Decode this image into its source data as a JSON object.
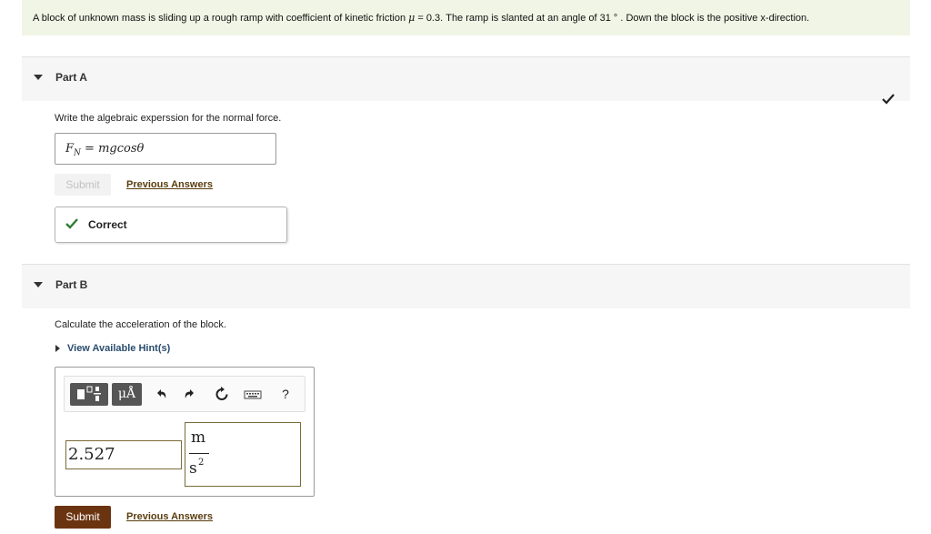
{
  "problem": {
    "text_before": "A block of unknown mass is sliding up a rough ramp with coefficient of kinetic friction ",
    "mu_symbol": "μ",
    "text_after": " = 0.3.  The ramp is slanted at an angle of 31 °  .  Down the block is the positive x-direction."
  },
  "part_a": {
    "title": "Part A",
    "prompt": "Write the algebraic experssion for the normal force.",
    "answer": "F",
    "answer_sub": "N",
    "answer_rest": " = mgcosθ",
    "submit_label": "Submit",
    "previous_answers_label": "Previous Answers",
    "feedback_label": "Correct"
  },
  "part_b": {
    "title": "Part B",
    "prompt": "Calculate the acceleration of the block.",
    "hint_label": "View Available Hint(s)",
    "toolbar": {
      "units_label": "μÅ",
      "help_label": "?"
    },
    "value": "2.527",
    "unit_numerator": "m",
    "unit_denominator": "s",
    "unit_exponent": "2",
    "submit_label": "Submit",
    "previous_answers_label": "Previous Answers"
  },
  "colors": {
    "accent_brown": "#6b3410",
    "correct_green": "#2e7d32",
    "problem_bg": "#f1f5e6"
  }
}
